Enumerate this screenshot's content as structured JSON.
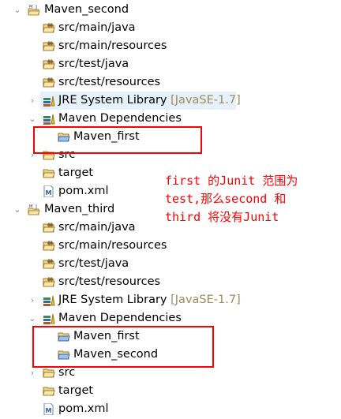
{
  "tree": [
    {
      "label": "Maven_second",
      "level": 0,
      "icon": "maven-project-icon",
      "chevron": "expanded"
    },
    {
      "label": "src/main/java",
      "level": 1,
      "icon": "package-folder-icon"
    },
    {
      "label": "src/main/resources",
      "level": 1,
      "icon": "package-folder-icon"
    },
    {
      "label": "src/test/java",
      "level": 1,
      "icon": "package-folder-icon"
    },
    {
      "label": "src/test/resources",
      "level": 1,
      "icon": "package-folder-icon"
    },
    {
      "label": "JRE System Library",
      "decoration": "[JavaSE-1.7]",
      "level": 1,
      "icon": "library-icon",
      "chevron": "collapsed",
      "highlight": true
    },
    {
      "label": "Maven Dependencies",
      "level": 1,
      "icon": "library-icon",
      "chevron": "expanded"
    },
    {
      "label": "Maven_first",
      "level": 2,
      "icon": "project-folder-icon"
    },
    {
      "label": "src",
      "level": 1,
      "icon": "folder-icon",
      "chevron": "collapsed"
    },
    {
      "label": "target",
      "level": 1,
      "icon": "folder-icon"
    },
    {
      "label": "pom.xml",
      "level": 1,
      "icon": "maven-file-icon"
    },
    {
      "label": "Maven_third",
      "level": 0,
      "icon": "maven-project-icon",
      "chevron": "expanded"
    },
    {
      "label": "src/main/java",
      "level": 1,
      "icon": "package-folder-icon"
    },
    {
      "label": "src/main/resources",
      "level": 1,
      "icon": "package-folder-icon"
    },
    {
      "label": "src/test/java",
      "level": 1,
      "icon": "package-folder-icon"
    },
    {
      "label": "src/test/resources",
      "level": 1,
      "icon": "package-folder-icon"
    },
    {
      "label": "JRE System Library",
      "decoration": "[JavaSE-1.7]",
      "level": 1,
      "icon": "library-icon",
      "chevron": "collapsed"
    },
    {
      "label": "Maven Dependencies",
      "level": 1,
      "icon": "library-icon",
      "chevron": "expanded"
    },
    {
      "label": "Maven_first",
      "level": 2,
      "icon": "project-folder-icon"
    },
    {
      "label": "Maven_second",
      "level": 2,
      "icon": "project-folder-icon"
    },
    {
      "label": "src",
      "level": 1,
      "icon": "folder-icon",
      "chevron": "collapsed"
    },
    {
      "label": "target",
      "level": 1,
      "icon": "folder-icon"
    },
    {
      "label": "pom.xml",
      "level": 1,
      "icon": "maven-file-icon"
    }
  ],
  "annotation": {
    "lines": [
      "first 的Junit 范围为",
      "test,那么second 和",
      "third 将没有Junit"
    ],
    "color": "#ff0000"
  }
}
